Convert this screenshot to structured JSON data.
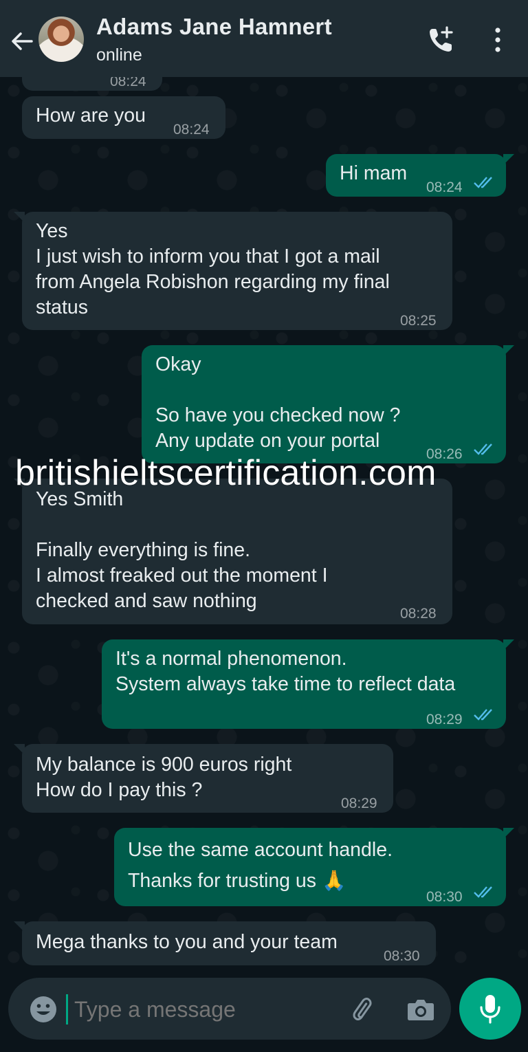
{
  "header": {
    "contact_name": "Adams Jane Hamnert",
    "status": "online"
  },
  "messages": [
    {
      "direction": "in",
      "text": "",
      "time": "08:24"
    },
    {
      "direction": "in",
      "text": "How are you",
      "time": "08:24"
    },
    {
      "direction": "out",
      "text": "Hi mam",
      "time": "08:24",
      "read": true
    },
    {
      "direction": "in",
      "text": "Yes\nI just wish to inform you that I got a mail\nfrom Angela Robishon regarding my final\nstatus",
      "time": "08:25"
    },
    {
      "direction": "out",
      "text": "Okay\n\nSo have you checked now ?\nAny update on your portal",
      "time": "08:26",
      "read": true
    },
    {
      "direction": "in",
      "text": "Yes Smith\n\nFinally everything is fine.\nI almost freaked out the moment I\nchecked and saw nothing",
      "time": "08:28"
    },
    {
      "direction": "out",
      "text": "It's a normal phenomenon.\nSystem always take time to reflect data",
      "time": "08:29",
      "read": true
    },
    {
      "direction": "in",
      "text": "My balance is 900 euros right\nHow do I pay this ?",
      "time": "08:29"
    },
    {
      "direction": "out",
      "text": "Use the same account handle.\nThanks for trusting us 🙏",
      "time": "08:30",
      "read": true
    },
    {
      "direction": "in",
      "text": "Mega thanks to you and your team",
      "time": "08:30"
    }
  ],
  "watermark": "britishieltscertification.com",
  "composer": {
    "placeholder": "Type a message"
  },
  "colors": {
    "background": "#0b141a",
    "header": "#1f2c33",
    "incoming_bubble": "#1f2c33",
    "outgoing_bubble": "#005c4b",
    "accent": "#00a884",
    "read_ticks": "#53bdeb"
  },
  "icons": {
    "back": "back-arrow-icon",
    "call": "add-call-icon",
    "menu": "more-vert-icon",
    "emoji": "emoji-icon",
    "attach": "paperclip-icon",
    "camera": "camera-icon",
    "mic": "mic-icon"
  }
}
